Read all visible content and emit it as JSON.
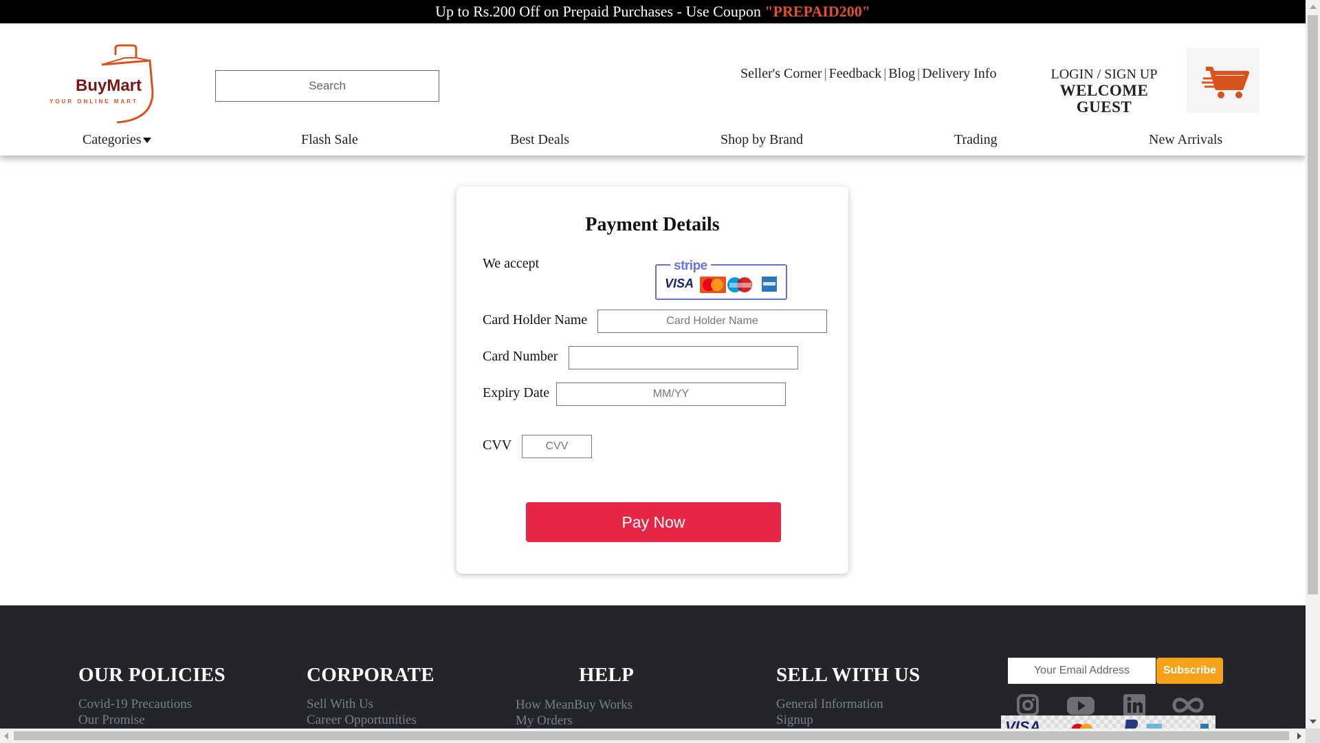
{
  "promo": {
    "text": "Up to Rs.200 Off on Prepaid Purchases - Use Coupon ",
    "code": "\"PREPAID200\""
  },
  "header": {
    "logo_name": "BuyMart",
    "logo_tagline": "YOUR ONLINE MART",
    "search_placeholder": "Search",
    "top_links": [
      "Seller's Corner",
      "Feedback",
      "Blog",
      "Delivery Info"
    ],
    "login_text": "LOGIN / SIGN UP",
    "welcome_text": "WELCOME GUEST",
    "cart_icon": "cart-icon",
    "brand_color": "#d9531e"
  },
  "nav": {
    "items": [
      "Categories",
      "Flash Sale",
      "Best Deals",
      "Shop by Brand",
      "Trading",
      "New Arrivals"
    ]
  },
  "payment": {
    "title": "Payment Details",
    "accept_label": "We accept",
    "accept_brand": "stripe",
    "card_logos": [
      "visa",
      "mastercard",
      "maestro",
      "amex"
    ],
    "card_holder_label": "Card Holder Name",
    "card_holder_placeholder": "Card Holder Name",
    "card_number_label": "Card Number",
    "card_number_placeholder": "",
    "expiry_label": "Expiry Date",
    "expiry_placeholder": "MM/YY",
    "cvv_label": "CVV",
    "cvv_placeholder": "CVV",
    "pay_button": "Pay Now",
    "pay_color": "#e52646"
  },
  "footer": {
    "columns": [
      {
        "title": "OUR POLICIES",
        "links": [
          "Covid-19 Precautions",
          "Our Promise"
        ]
      },
      {
        "title": "CORPORATE",
        "links": [
          "Sell With Us",
          "Career Opportunities"
        ]
      },
      {
        "title": "HELP",
        "links": [
          "How MeanBuy Works",
          "My Orders"
        ]
      },
      {
        "title": "SELL WITH US",
        "links": [
          "General Information",
          "Signup"
        ]
      }
    ],
    "email_placeholder": "Your Email Address",
    "subscribe_label": "Subscribe",
    "social_icons": [
      "instagram-icon",
      "youtube-icon",
      "linkedin-icon",
      "infinity-icon"
    ],
    "subscribe_color": "#f8a21b"
  }
}
